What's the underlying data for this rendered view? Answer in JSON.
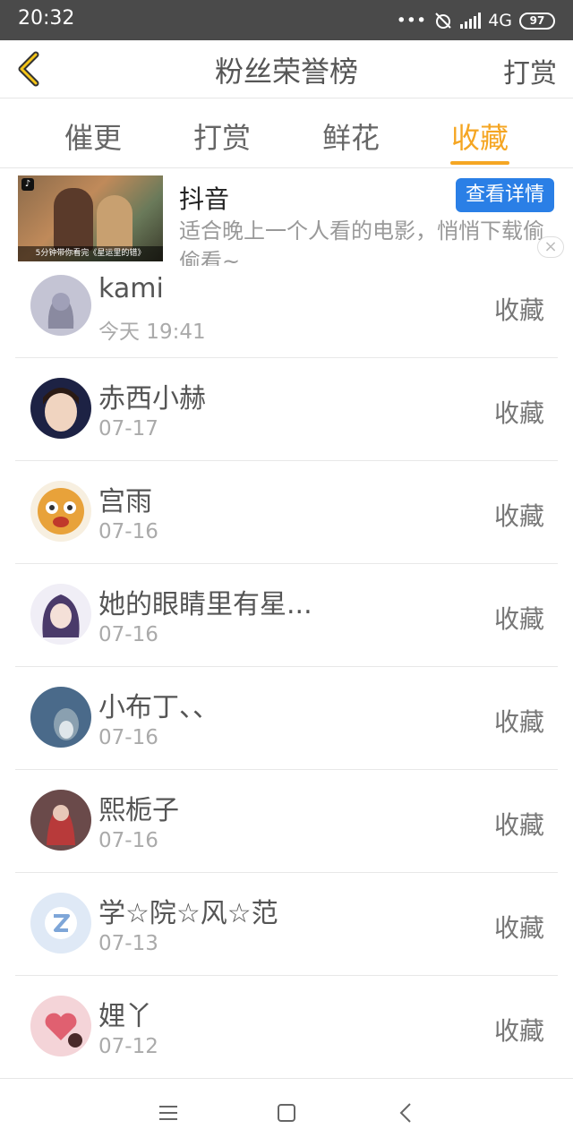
{
  "status": {
    "time": "20:32",
    "dots": "•••",
    "network": "4G",
    "battery": "97"
  },
  "nav": {
    "title": "粉丝荣誉榜",
    "reward": "打赏"
  },
  "tabs": [
    {
      "label": "催更"
    },
    {
      "label": "打赏"
    },
    {
      "label": "鲜花"
    },
    {
      "label": "收藏"
    }
  ],
  "active_tab": "收藏",
  "ad": {
    "title": "抖音",
    "button": "查看详情",
    "description": "适合晚上一个人看的电影，悄悄下载偷偷看~",
    "thumbnail_caption": "5分钟带你看完《星运里的错》",
    "close": "×"
  },
  "fans": [
    {
      "name": "kami",
      "date": "今天 19:41",
      "action": "收藏",
      "avatar_color": "#b9b9c9"
    },
    {
      "name": "赤西小赫",
      "date": "07-17",
      "action": "收藏",
      "avatar_color": "#1d2244"
    },
    {
      "name": "宫雨",
      "date": "07-16",
      "action": "收藏",
      "avatar_color": "#e8a23a"
    },
    {
      "name": "她的眼睛里有星...",
      "date": "07-16",
      "action": "收藏",
      "avatar_color": "#d9d6e8"
    },
    {
      "name": "小布丁、、",
      "date": "07-16",
      "action": "收藏",
      "avatar_color": "#5a7a9a"
    },
    {
      "name": "熙栀子",
      "date": "07-16",
      "action": "收藏",
      "avatar_color": "#8a4a4a"
    },
    {
      "name": "学☆院☆风☆范",
      "date": "07-13",
      "action": "收藏",
      "avatar_color": "#dfe9f6"
    },
    {
      "name": "娌丫",
      "date": "07-12",
      "action": "收藏",
      "avatar_color": "#e8a0a8"
    }
  ],
  "colors": {
    "accent": "#f5a623",
    "ad_button": "#2a7fe6",
    "status_bar": "#4a4a4a"
  }
}
